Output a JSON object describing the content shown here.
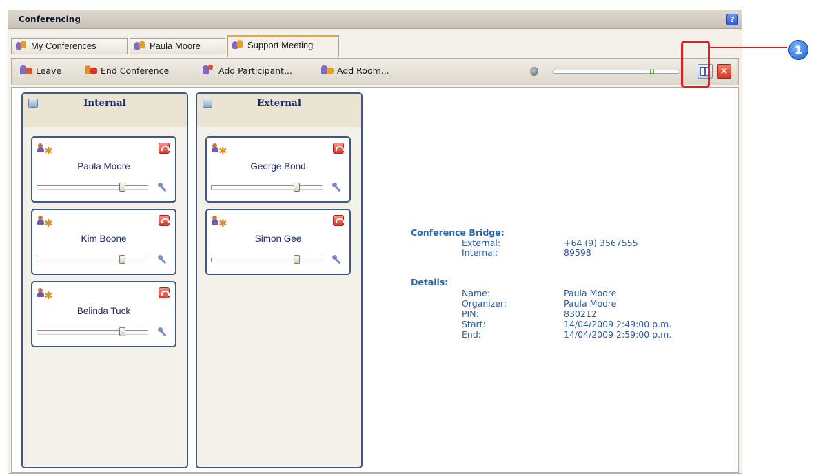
{
  "window": {
    "title": "Conferencing",
    "help_label": "?"
  },
  "tabs": [
    {
      "label": "My Conferences",
      "active": false
    },
    {
      "label": "Paula Moore",
      "active": false
    },
    {
      "label": "Support Meeting",
      "active": true
    }
  ],
  "toolbar": {
    "leave_label": "Leave",
    "end_conference_label": "End Conference",
    "add_participant_label": "Add Participant...",
    "add_room_label": "Add Room...",
    "master_volume": 0.79,
    "close_label": "×"
  },
  "columns": [
    {
      "title": "Internal",
      "participants": [
        {
          "name": "Paula Moore",
          "volume": 0.78
        },
        {
          "name": "Kim Boone",
          "volume": 0.78
        },
        {
          "name": "Belinda Tuck",
          "volume": 0.78
        }
      ]
    },
    {
      "title": "External",
      "participants": [
        {
          "name": "George Bond",
          "volume": 0.78
        },
        {
          "name": "Simon Gee",
          "volume": 0.78
        }
      ]
    }
  ],
  "info": {
    "bridge_header": "Conference Bridge:",
    "external_label": "External:",
    "external_value": "+64 (9) 3567555",
    "internal_label": "Internal:",
    "internal_value": "89598",
    "details_header": "Details:",
    "name_label": "Name:",
    "name_value": "Paula Moore",
    "organizer_label": "Organizer:",
    "organizer_value": "Paula Moore",
    "pin_label": "PIN:",
    "pin_value": "830212",
    "start_label": "Start:",
    "start_value": "14/04/2009 2:49:00 p.m.",
    "end_label": "End:",
    "end_value": "14/04/2009 2:59:00 p.m."
  },
  "callout": {
    "number": "1"
  },
  "colors": {
    "accent_blue": "#3c5a85",
    "tab_highlight": "#f0a429",
    "callout_red": "#e81c1c"
  }
}
